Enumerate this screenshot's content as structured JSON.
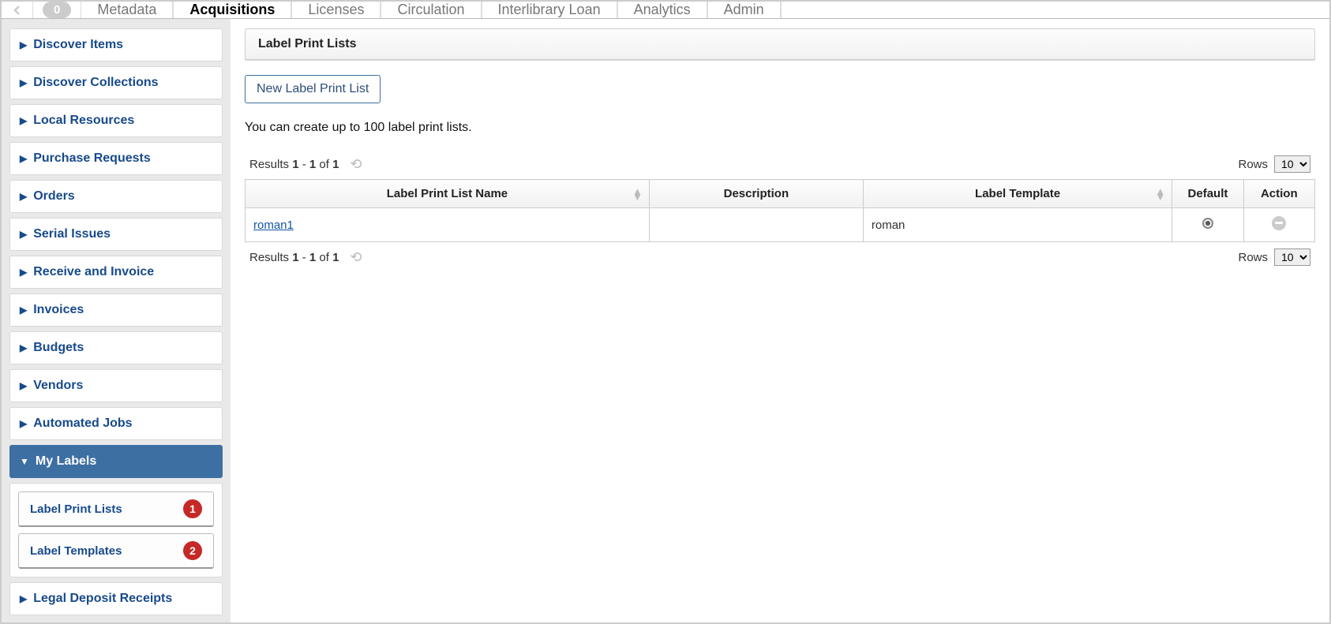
{
  "topbar": {
    "badge_count": "0",
    "tabs": [
      {
        "label": "Metadata",
        "active": false
      },
      {
        "label": "Acquisitions",
        "active": true
      },
      {
        "label": "Licenses",
        "active": false
      },
      {
        "label": "Circulation",
        "active": false
      },
      {
        "label": "Interlibrary Loan",
        "active": false
      },
      {
        "label": "Analytics",
        "active": false
      },
      {
        "label": "Admin",
        "active": false
      }
    ]
  },
  "sidebar": {
    "items": [
      {
        "label": "Discover Items"
      },
      {
        "label": "Discover Collections"
      },
      {
        "label": "Local Resources"
      },
      {
        "label": "Purchase Requests"
      },
      {
        "label": "Orders"
      },
      {
        "label": "Serial Issues"
      },
      {
        "label": "Receive and Invoice"
      },
      {
        "label": "Invoices"
      },
      {
        "label": "Budgets"
      },
      {
        "label": "Vendors"
      },
      {
        "label": "Automated Jobs"
      }
    ],
    "selected": {
      "label": "My Labels"
    },
    "sub_items": [
      {
        "label": "Label Print Lists",
        "badge": "1"
      },
      {
        "label": "Label Templates",
        "badge": "2"
      }
    ],
    "after_items": [
      {
        "label": "Legal Deposit Receipts"
      }
    ]
  },
  "main": {
    "panel_title": "Label Print Lists",
    "new_button": "New Label Print List",
    "info_text": "You can create up to 100 label print lists.",
    "pager": {
      "results_prefix": "Results ",
      "range_from": "1",
      "range_sep": " - ",
      "range_to": "1",
      "of_text": " of ",
      "total": "1",
      "rows_label": "Rows",
      "rows_value": "10"
    },
    "table": {
      "headers": {
        "name": "Label Print List Name",
        "description": "Description",
        "template": "Label Template",
        "default": "Default",
        "action": "Action"
      },
      "rows": [
        {
          "name": "roman1",
          "description": "",
          "template": "roman",
          "default": true
        }
      ]
    }
  }
}
